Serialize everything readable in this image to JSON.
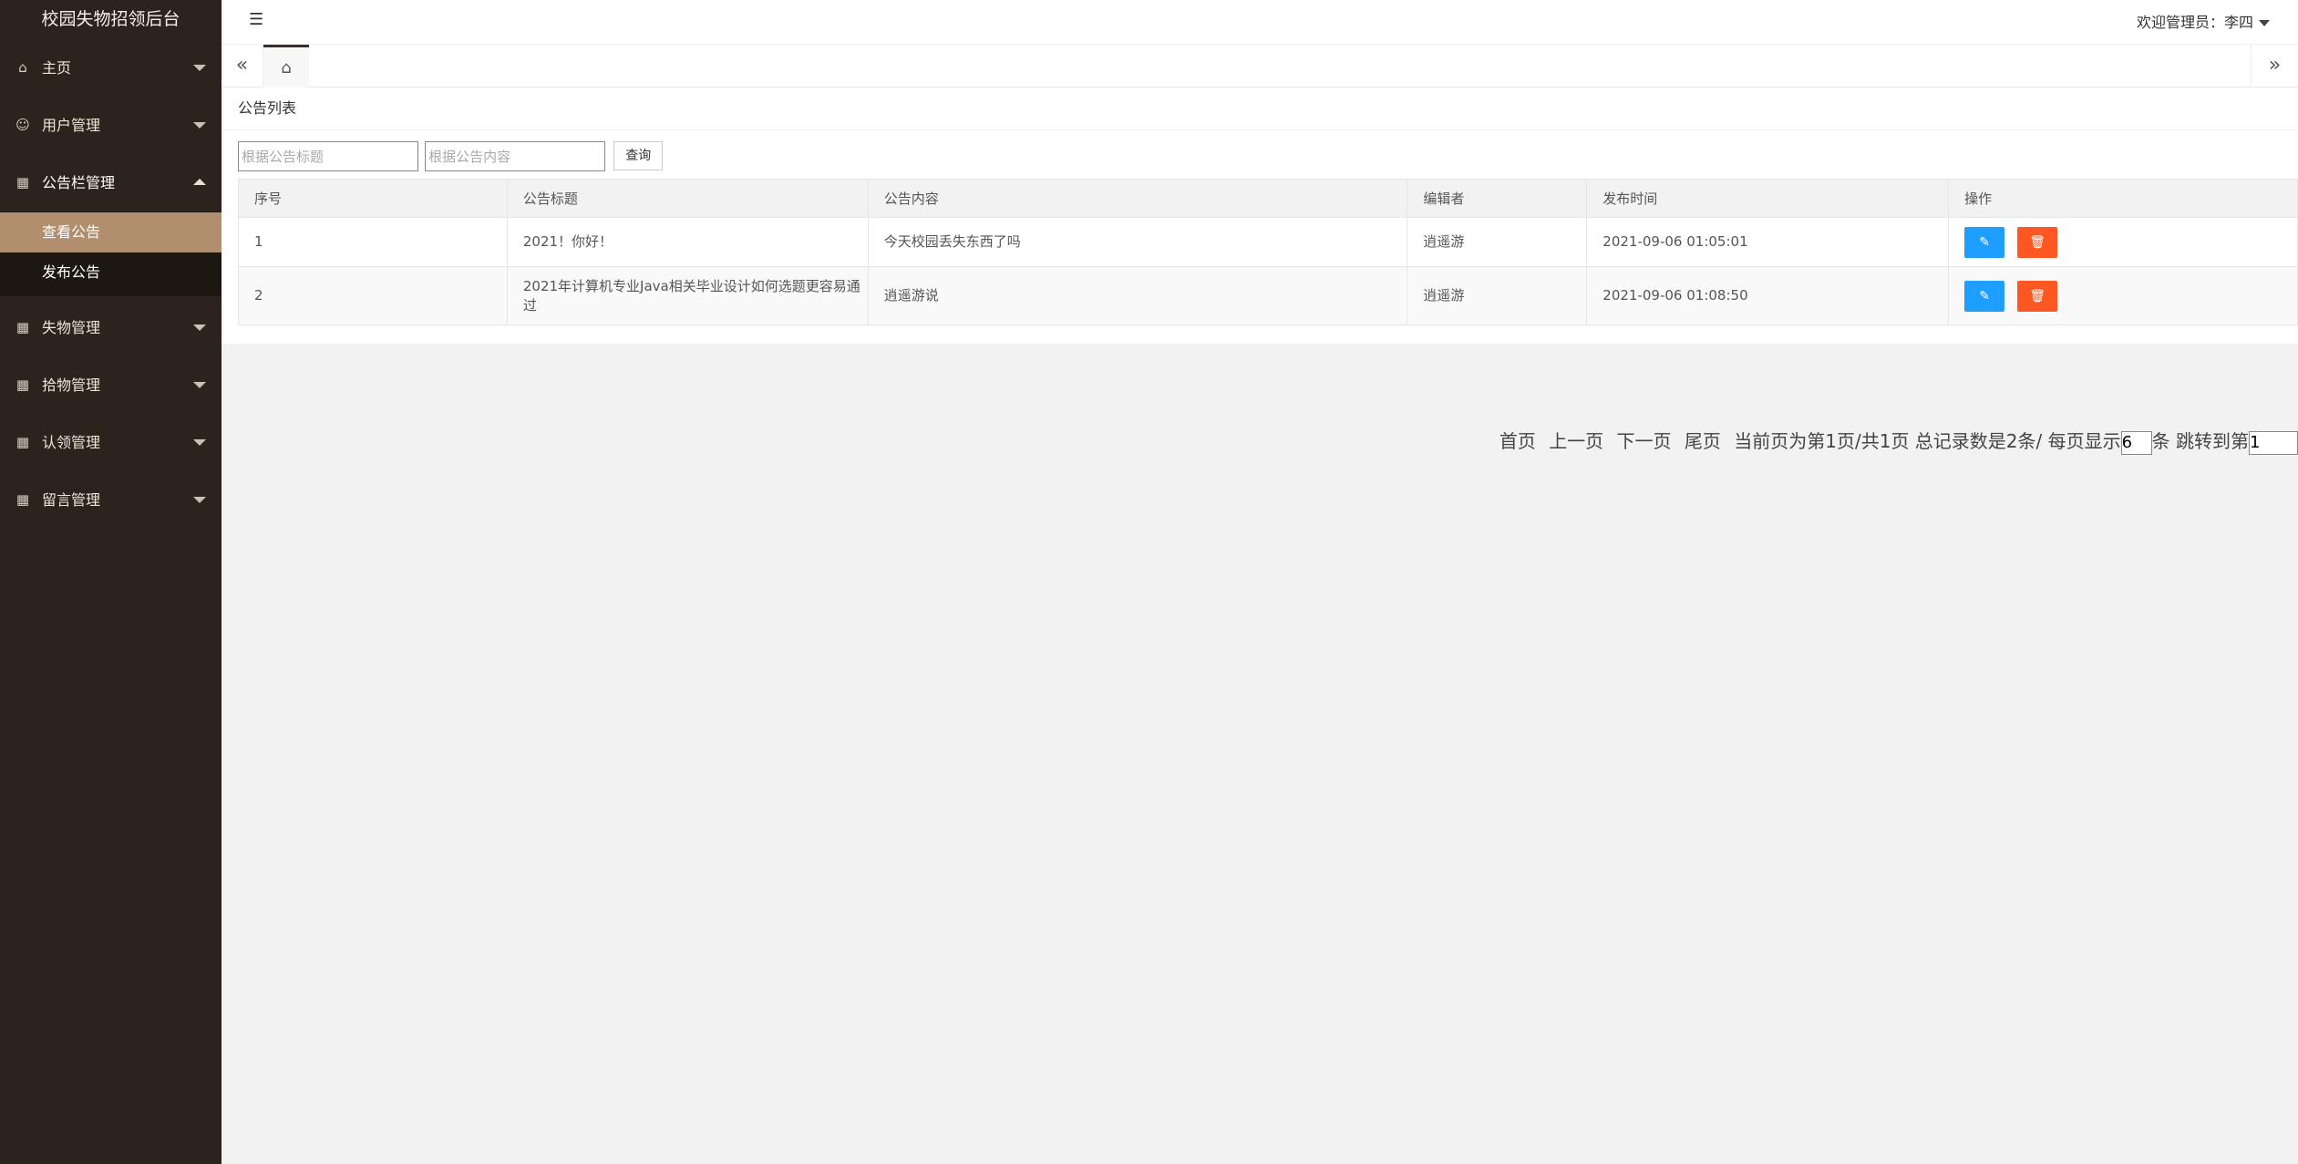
{
  "sidebar": {
    "logo": "校园失物招领后台",
    "items": [
      {
        "label": "主页",
        "icon": "home-icon"
      },
      {
        "label": "用户管理",
        "icon": "user-icon"
      },
      {
        "label": "公告栏管理",
        "icon": "calendar-icon"
      },
      {
        "label": "失物管理",
        "icon": "calendar-icon"
      },
      {
        "label": "拾物管理",
        "icon": "calendar-icon"
      },
      {
        "label": "认领管理",
        "icon": "calendar-icon"
      },
      {
        "label": "留言管理",
        "icon": "calendar-icon"
      }
    ],
    "submenu": [
      {
        "label": "查看公告",
        "active": true
      },
      {
        "label": "发布公告",
        "active": false
      }
    ],
    "colors": {
      "background": "#2b231c",
      "active": "#b08e6e"
    }
  },
  "header": {
    "welcome": "欢迎管理员：李四"
  },
  "main": {
    "card_title": "公告列表",
    "search": {
      "title_placeholder": "根据公告标题",
      "content_placeholder": "根据公告内容",
      "button": "查询"
    },
    "table": {
      "headers": [
        "序号",
        "公告标题",
        "公告内容",
        "编辑者",
        "发布时间",
        "操作"
      ],
      "rows": [
        {
          "no": "1",
          "title": "2021！你好！",
          "content": "今天校园丢失东西了吗",
          "editor": "逍遥游",
          "time": "2021-09-06 01:05:01"
        },
        {
          "no": "2",
          "title": "2021年计算机专业Java相关毕业设计如何选题更容易通过",
          "content": "逍遥游说",
          "editor": "逍遥游",
          "time": "2021-09-06 01:08:50"
        }
      ]
    },
    "pager": {
      "first": "首页",
      "prev": "上一页",
      "next": "下一页",
      "last": "尾页",
      "info": "当前页为第1页/共1页 总记录数是2条/ 每页显示",
      "page_size": "6",
      "unit": "条",
      "goto": "跳转到第",
      "goto_value": "1"
    },
    "colors": {
      "edit": "#1e9fff",
      "delete": "#ff5722"
    }
  }
}
